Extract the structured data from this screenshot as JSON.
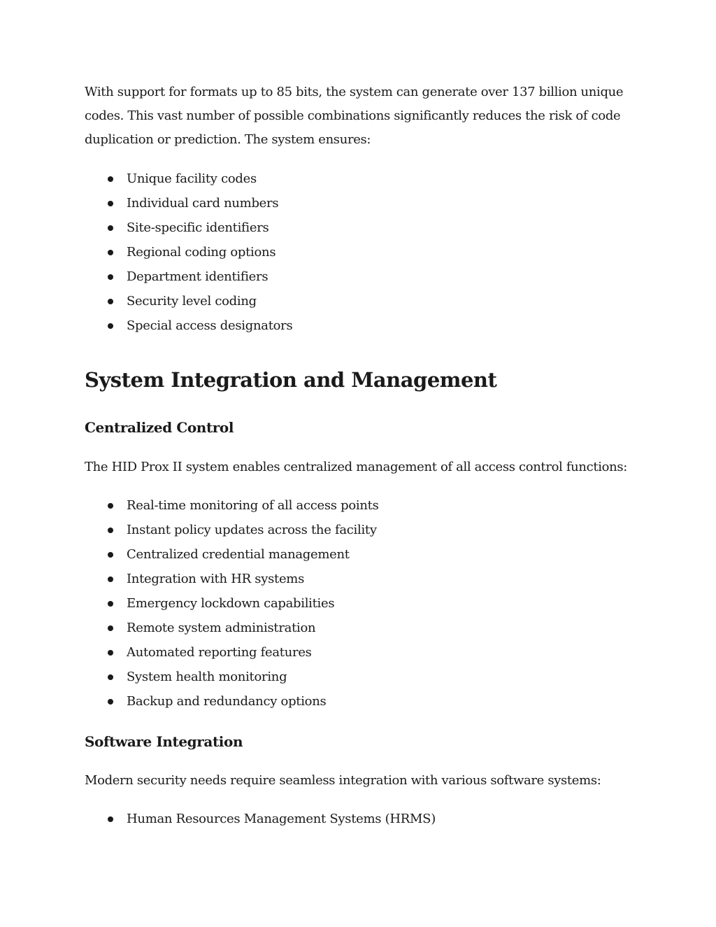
{
  "intro": {
    "line1": "With support for formats up to 85 bits, the system can generate over 137 billion unique",
    "line2": "codes. This vast number of possible combinations significantly reduces the risk of code",
    "line3": "duplication or prediction. The system ensures:"
  },
  "ensures_list": [
    "Unique facility codes",
    "Individual card numbers",
    "Site-specific identifiers",
    "Regional coding options",
    "Department identifiers",
    "Security level coding",
    "Special access designators"
  ],
  "section": {
    "title": "System Integration and Management"
  },
  "centralized": {
    "heading": "Centralized Control",
    "intro": "The HID Prox II system enables centralized management of all access control functions:",
    "items": [
      "Real-time monitoring of all access points",
      "Instant policy updates across the facility",
      "Centralized credential management",
      "Integration with HR systems",
      "Emergency lockdown capabilities",
      "Remote system administration",
      "Automated reporting features",
      "System health monitoring",
      "Backup and redundancy options"
    ]
  },
  "software": {
    "heading": "Software Integration",
    "intro": "Modern security needs require seamless integration with various software systems:",
    "items": [
      "Human Resources Management Systems (HRMS)"
    ]
  }
}
